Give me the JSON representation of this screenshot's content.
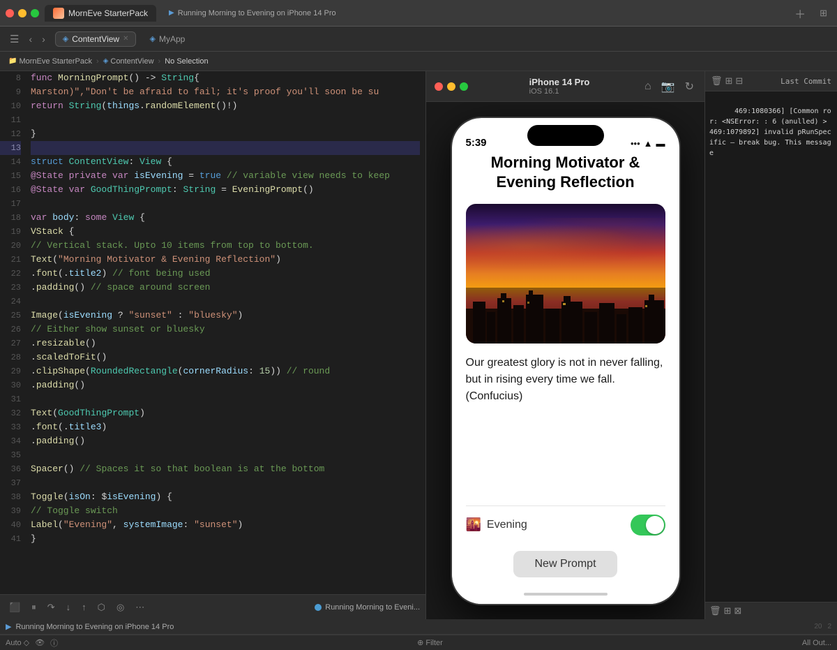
{
  "window": {
    "title": "MornEve StarterPack",
    "app_icon": "sunrise-icon"
  },
  "title_bar": {
    "app_tab_label": "MornEve StarterPack",
    "running_tab": "Running Morning to Evening on iPhone 14 Pro",
    "running_tab_short": "Running Morning to Eveni..."
  },
  "toolbar": {
    "tab_contentview": "ContentView",
    "tab_myapp": "MyApp"
  },
  "breadcrumb": {
    "app": "MornEve StarterPack",
    "file": "ContentView",
    "selection": "No Selection"
  },
  "code": {
    "lines": [
      {
        "num": 8,
        "text": "func MorningPrompt() -> String{",
        "highlight": false
      },
      {
        "num": 9,
        "text": "    Marston)\",\"Don't be afraid to fail; it's proof you'll soon be su",
        "highlight": false
      },
      {
        "num": 10,
        "text": "    return String(things.randomElement()!)",
        "highlight": false
      },
      {
        "num": 11,
        "text": "",
        "highlight": false
      },
      {
        "num": 12,
        "text": "}",
        "highlight": false
      },
      {
        "num": 13,
        "text": "",
        "highlight": true
      },
      {
        "num": 14,
        "text": "struct ContentView: View {",
        "highlight": false
      },
      {
        "num": 15,
        "text": "    @State private var isEvening = true // variable view needs to keep",
        "highlight": false
      },
      {
        "num": 16,
        "text": "    @State var GoodThingPrompt: String = EveningPrompt()",
        "highlight": false
      },
      {
        "num": 17,
        "text": "",
        "highlight": false
      },
      {
        "num": 18,
        "text": "    var body: some View {",
        "highlight": false
      },
      {
        "num": 19,
        "text": "        VStack {",
        "highlight": false
      },
      {
        "num": 20,
        "text": "            // Vertical stack. Upto 10 items from top to bottom.",
        "highlight": false
      },
      {
        "num": 21,
        "text": "            Text(\"Morning Motivator & Evening Reflection\")",
        "highlight": false
      },
      {
        "num": 22,
        "text": "                .font(.title2) // font being used",
        "highlight": false
      },
      {
        "num": 23,
        "text": "                .padding() // space around screen",
        "highlight": false
      },
      {
        "num": 24,
        "text": "",
        "highlight": false
      },
      {
        "num": 25,
        "text": "            Image(isEvening ? \"sunset\" : \"bluesky\")",
        "highlight": false
      },
      {
        "num": 26,
        "text": "            // Either show sunset or bluesky",
        "highlight": false
      },
      {
        "num": 27,
        "text": "                .resizable()",
        "highlight": false
      },
      {
        "num": 28,
        "text": "                .scaledToFit()",
        "highlight": false
      },
      {
        "num": 29,
        "text": "                .clipShape(RoundedRectangle(cornerRadius: 15)) // round",
        "highlight": false
      },
      {
        "num": 30,
        "text": "                .padding()",
        "highlight": false
      },
      {
        "num": 31,
        "text": "",
        "highlight": false
      },
      {
        "num": 32,
        "text": "            Text(GoodThingPrompt)",
        "highlight": false
      },
      {
        "num": 33,
        "text": "                        .font(.title3)",
        "highlight": false
      },
      {
        "num": 34,
        "text": "                        .padding()",
        "highlight": false
      },
      {
        "num": 35,
        "text": "",
        "highlight": false
      },
      {
        "num": 36,
        "text": "            Spacer() // Spaces it so that boolean is at the bottom",
        "highlight": false
      },
      {
        "num": 37,
        "text": "",
        "highlight": false
      },
      {
        "num": 38,
        "text": "            Toggle(isOn: $isEvening) {",
        "highlight": false
      },
      {
        "num": 39,
        "text": "                // Toggle switch",
        "highlight": false
      },
      {
        "num": 40,
        "text": "                Label(\"Evening\", systemImage: \"sunset\")",
        "highlight": false
      },
      {
        "num": 41,
        "text": "            }",
        "highlight": false
      }
    ]
  },
  "simulator": {
    "device_name": "iPhone 14 Pro",
    "os": "iOS 16.1",
    "time": "5:39",
    "app_title_line1": "Morning Motivator &",
    "app_title_line2": "Evening Reflection",
    "quote": "Our greatest glory is not in never falling, but in rising every time we fall. (Confucius)",
    "toggle_label": "Evening",
    "toggle_on": true,
    "new_prompt_btn": "New Prompt"
  },
  "debug": {
    "header_label": "Last Commit",
    "content": ": 6 (anulled) > 469:1079892] invalid pRunSpecific – break bug. This message",
    "content_full": "469:1080366] [Common ror: <NSError: : 6 (anulled) > 469:1079892] invalid pRunSpecific – break bug. This message"
  },
  "running_bar": {
    "text": "Running Morning to Evening on iPhone 14 Pro"
  },
  "status_bar": {
    "left": "Auto ◇",
    "center": "⊕ Filter",
    "right": "All Out..."
  },
  "icons": {
    "close": "🔴",
    "minimize": "🟡",
    "maximize": "🟢"
  }
}
